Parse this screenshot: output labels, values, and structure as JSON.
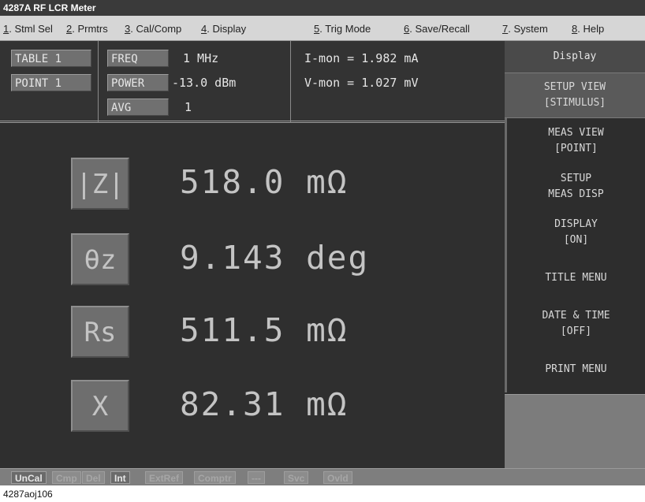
{
  "window": {
    "title": "4287A RF LCR Meter"
  },
  "menu": [
    {
      "key": "1",
      "label": ". Stml Sel"
    },
    {
      "key": "2",
      "label": ". Prmtrs"
    },
    {
      "key": "3",
      "label": ". Cal/Comp"
    },
    {
      "key": "4",
      "label": ". Display"
    },
    {
      "key": "5",
      "label": ". Trig Mode"
    },
    {
      "key": "6",
      "label": ". Save/Recall"
    },
    {
      "key": "7",
      "label": ". System"
    },
    {
      "key": "8",
      "label": ". Help"
    }
  ],
  "stimulus": {
    "table_label": "TABLE 1",
    "point_label": "POINT 1",
    "freq_label": "FREQ",
    "freq_value": "1 MHz",
    "power_label": "POWER",
    "power_value": "-13.0 dBm",
    "avg_label": "AVG",
    "avg_value": "1",
    "imon": "I-mon = 1.982 mA",
    "vmon": "V-mon = 1.027 mV"
  },
  "measurements": [
    {
      "param": "|Z|",
      "value": "518.0 mΩ"
    },
    {
      "param": "θz",
      "value": "9.143 deg"
    },
    {
      "param": "Rs",
      "value": "511.5 mΩ"
    },
    {
      "param": "X",
      "value": "82.31 mΩ"
    }
  ],
  "softkeys": {
    "title": "Display",
    "setup_view": [
      "SETUP VIEW",
      "[STIMULUS]"
    ],
    "meas_view": [
      "MEAS VIEW",
      "[POINT]"
    ],
    "setup_meas_disp": [
      "SETUP",
      "MEAS DISP"
    ],
    "display": [
      "DISPLAY",
      "[ON]"
    ],
    "title_menu": "TITLE MENU",
    "date_time": [
      "DATE & TIME",
      "[OFF]"
    ],
    "print_menu": "PRINT MENU"
  },
  "status": [
    {
      "label": "UnCal",
      "active": true
    },
    {
      "label": "Cmp",
      "active": false
    },
    {
      "label": "Del",
      "active": false
    },
    {
      "label": "Int",
      "active": true
    },
    {
      "label": "ExtRef",
      "active": false
    },
    {
      "label": "Comptr",
      "active": false
    },
    {
      "label": "---",
      "active": false
    },
    {
      "label": "Svc",
      "active": false
    },
    {
      "label": "Ovld",
      "active": false
    }
  ],
  "caption": "4287aoj106"
}
